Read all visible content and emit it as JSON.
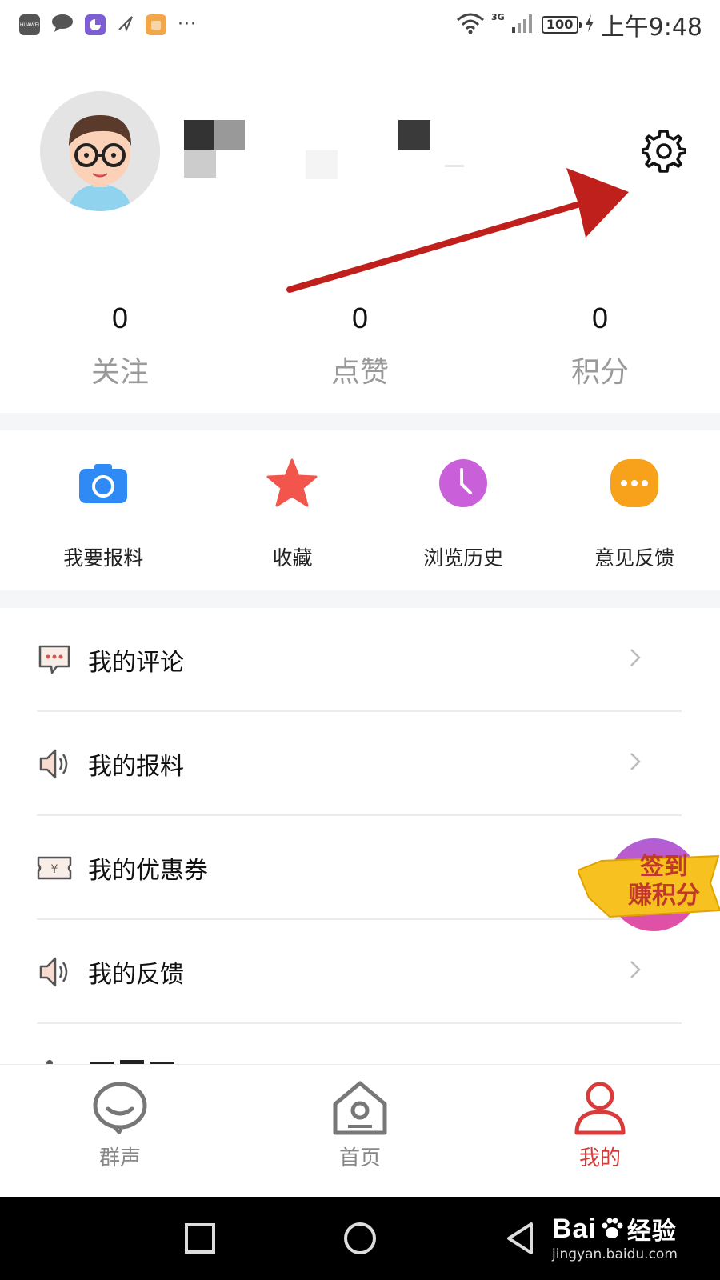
{
  "status_bar": {
    "time": "上午9:48",
    "battery": "100",
    "network": "3G",
    "brand_label": "HUAWEI",
    "more": "···"
  },
  "stats": [
    {
      "value": "0",
      "label": "关注"
    },
    {
      "value": "0",
      "label": "点赞"
    },
    {
      "value": "0",
      "label": "积分"
    }
  ],
  "quick_actions": [
    {
      "label": "我要报料",
      "icon": "camera-icon",
      "color": "#2f8af5"
    },
    {
      "label": "收藏",
      "icon": "star-icon",
      "color": "#f2554b"
    },
    {
      "label": "浏览历史",
      "icon": "clock-icon",
      "color": "#c95fd9"
    },
    {
      "label": "意见反馈",
      "icon": "more-dots-icon",
      "color": "#f7a21a"
    }
  ],
  "menu": [
    {
      "label": "我的评论",
      "icon": "comment-icon"
    },
    {
      "label": "我的报料",
      "icon": "speaker-icon"
    },
    {
      "label": "我的优惠券",
      "icon": "coupon-icon"
    },
    {
      "label": "我的反馈",
      "icon": "speaker-icon"
    }
  ],
  "signin_badge": {
    "line1": "签到",
    "line2": "赚积分"
  },
  "tabs": [
    {
      "label": "群声",
      "icon": "chat-smile-icon",
      "active": false
    },
    {
      "label": "首页",
      "icon": "home-icon",
      "active": false
    },
    {
      "label": "我的",
      "icon": "person-icon",
      "active": true
    }
  ],
  "watermark": {
    "main": "Bai",
    "suffix": "经验",
    "sub": "jingyan.baidu.com"
  },
  "colors": {
    "accent": "#d93a3a",
    "annotation_arrow": "#c0201b"
  }
}
